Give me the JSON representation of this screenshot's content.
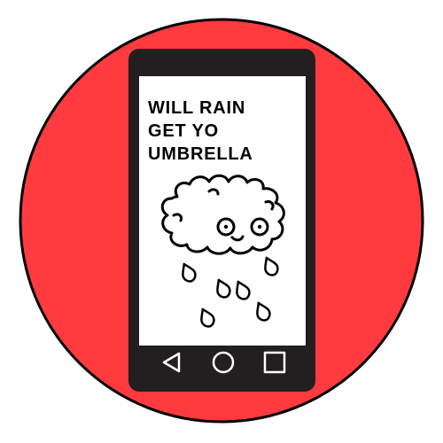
{
  "screen": {
    "message_lines": [
      "WILL RAIN",
      "GET YO",
      "UMBRELLA"
    ]
  },
  "nav_bar": {
    "buttons": [
      {
        "name": "back-button",
        "icon": "triangle-back-icon"
      },
      {
        "name": "home-button",
        "icon": "circle-home-icon"
      },
      {
        "name": "recents-button",
        "icon": "square-recents-icon"
      }
    ]
  },
  "illustration": {
    "subject": "rain-cloud-character-icon",
    "raindrop_count": 6
  },
  "colors": {
    "badge_background": "#ff3b3f",
    "badge_outline": "#000000",
    "phone_body": "#231f20",
    "screen": "#ffffff",
    "ink": "#000000"
  }
}
